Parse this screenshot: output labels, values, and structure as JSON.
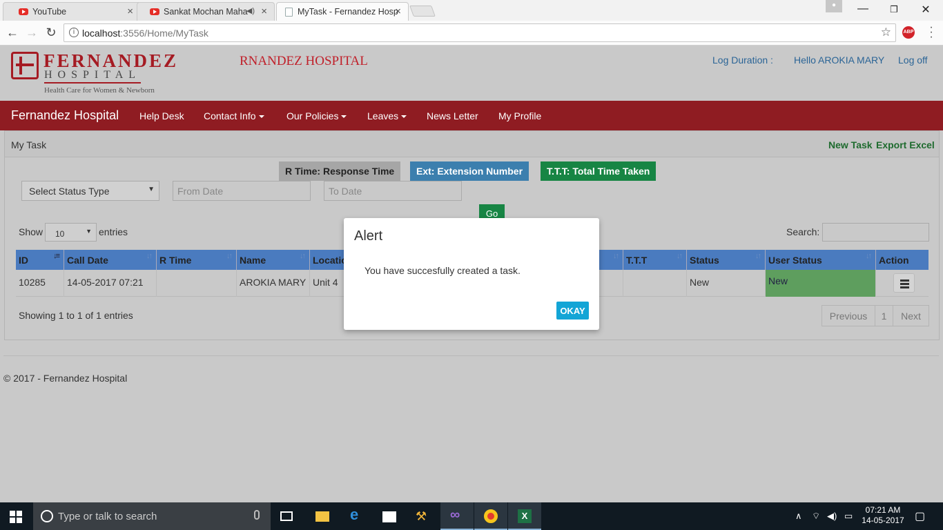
{
  "browser": {
    "tabs": [
      {
        "title": "YouTube"
      },
      {
        "title": "Sankat Mochan Maha"
      },
      {
        "title": "MyTask - Fernandez Hosp"
      }
    ],
    "url_host": "localhost",
    "url_rest": ":3556/Home/MyTask",
    "abp_label": "ABP"
  },
  "header": {
    "logo_name": "FERNANDEZ",
    "logo_sub": "HOSPITAL",
    "logo_tag": "Health Care for Women & Newborn",
    "marquee": "RNANDEZ HOSPITAL",
    "log_duration": "Log Duration :",
    "greeting": "Hello AROKIA MARY",
    "logoff": "Log off"
  },
  "navbar": {
    "brand": "Fernandez Hospital",
    "items": [
      "Help Desk",
      "Contact Info",
      "Our Policies",
      "Leaves",
      "News Letter",
      "My Profile"
    ]
  },
  "panel": {
    "title": "My Task",
    "new_task": "New Task",
    "export_excel": "Export Excel"
  },
  "legend": {
    "rtime": "R Time: Response Time",
    "ext": "Ext: Extension Number",
    "ttt": "T.T.T: Total Time Taken",
    "colors": {
      "rtime": "#a6a6a6",
      "ext": "#3c7fae",
      "ttt": "#178544"
    }
  },
  "filters": {
    "status_select": "Select Status Type",
    "from_placeholder": "From Date",
    "to_placeholder": "To Date",
    "go": "Go"
  },
  "table_controls": {
    "show": "Show",
    "page_length": "10",
    "entries": "entries",
    "search_label": "Search:"
  },
  "table": {
    "headers": [
      "ID",
      "Call Date",
      "R Time",
      "Name",
      "Locatio",
      "T.T.T",
      "Status",
      "User Status",
      "Action"
    ],
    "rows": [
      {
        "id": "10285",
        "call_date": "14-05-2017 07:21",
        "r_time": "",
        "name": "AROKIA MARY",
        "location": "Unit 4",
        "ttt": "",
        "status": "New",
        "user_status": "New"
      }
    ],
    "info": "Showing 1 to 1 of 1 entries",
    "pager": {
      "previous": "Previous",
      "page": "1",
      "next": "Next"
    }
  },
  "footer": "© 2017 - Fernandez Hospital",
  "modal": {
    "title": "Alert",
    "message": "You have succesfully created a task.",
    "ok": "OKAY"
  },
  "taskbar": {
    "search_placeholder": "Type or talk to search",
    "time": "07:21 AM",
    "date": "14-05-2017"
  }
}
